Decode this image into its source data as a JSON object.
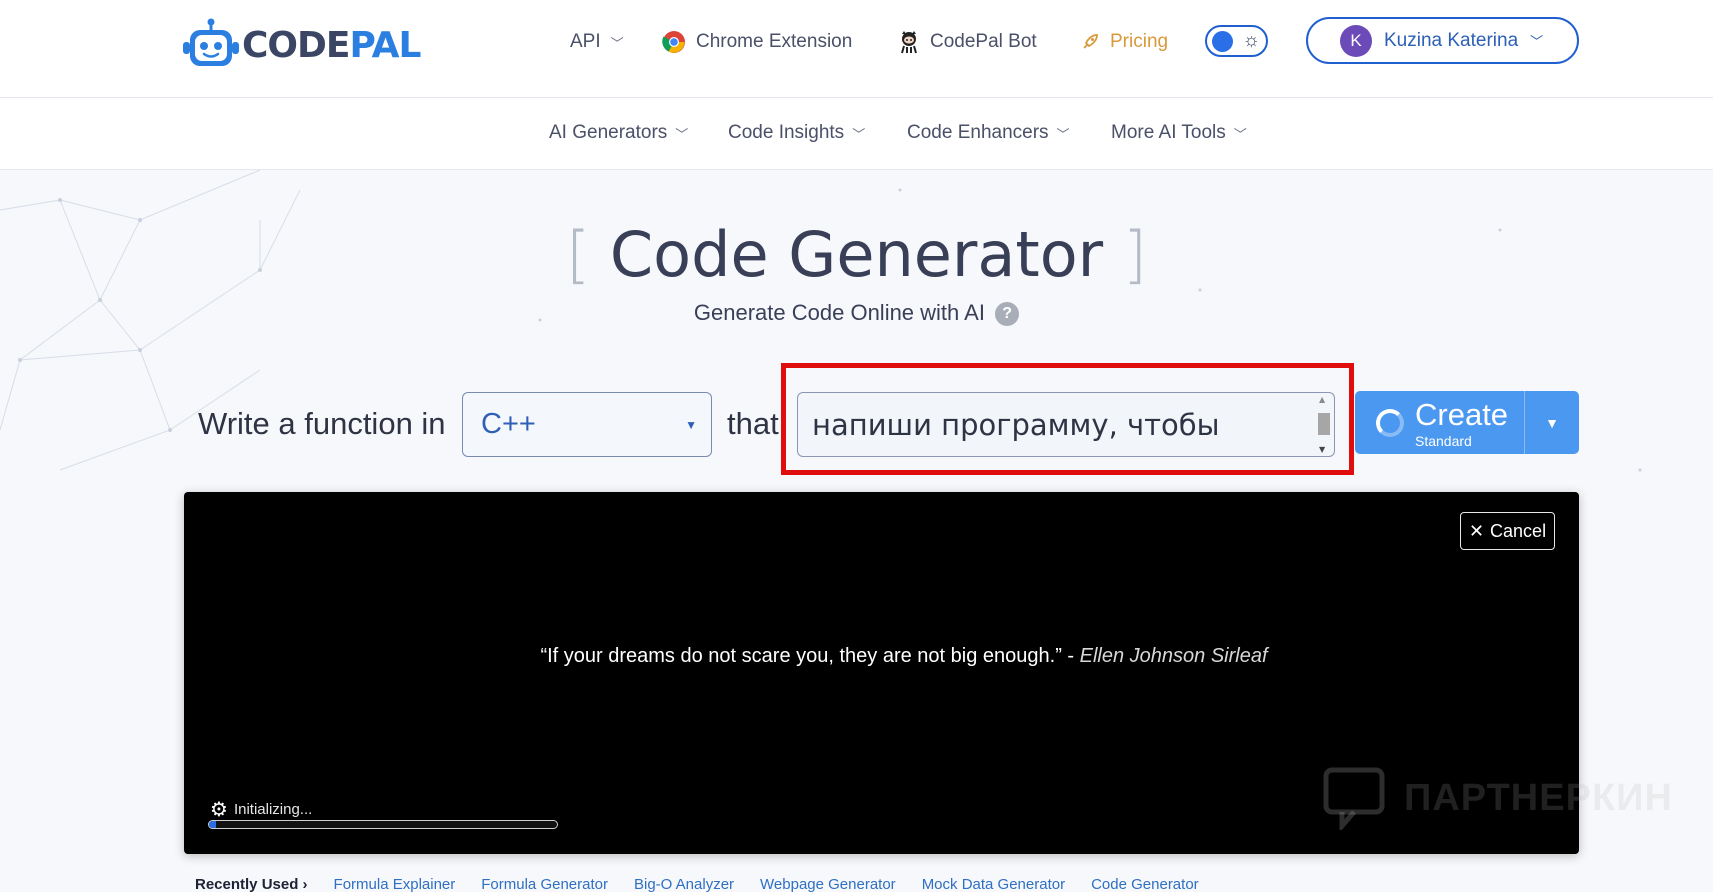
{
  "header": {
    "logo_code": "CODE",
    "logo_pal": "PAL",
    "nav": {
      "api": "API",
      "chrome_extension": "Chrome Extension",
      "bot": "CodePal Bot",
      "pricing": "Pricing"
    },
    "user": {
      "initial": "K",
      "name": "Kuzina Katerina"
    }
  },
  "subnav": {
    "items": [
      "AI Generators",
      "Code Insights",
      "Code Enhancers",
      "More AI Tools"
    ]
  },
  "page": {
    "title": "Code Generator",
    "bracket_open": "[",
    "bracket_close": "]",
    "subtitle": "Generate Code Online with AI",
    "help": "?"
  },
  "prompt": {
    "prefix": "Write a function in",
    "language": "C++",
    "connector": "that",
    "text": "напиши программу, чтобы"
  },
  "create": {
    "label": "Create",
    "mode": "Standard"
  },
  "loading": {
    "cancel": "Cancel",
    "quote": "“If your dreams do not scare you, they are not big enough.”",
    "separator": " - ",
    "author": "Ellen Johnson Sirleaf",
    "status": "Initializing...",
    "progress_fraction": 0.02
  },
  "watermark": "ПАРТНЕРКИН",
  "recent": {
    "label": "Recently Used ›",
    "items": [
      "Formula Explainer",
      "Formula Generator",
      "Big-O Analyzer",
      "Webpage Generator",
      "Mock Data Generator",
      "Code Generator"
    ]
  },
  "colors": {
    "brand_blue": "#2a7fe0",
    "accent_blue": "#4b98f0",
    "highlight_red": "#e00d0d",
    "pricing_orange": "#d9993a"
  }
}
